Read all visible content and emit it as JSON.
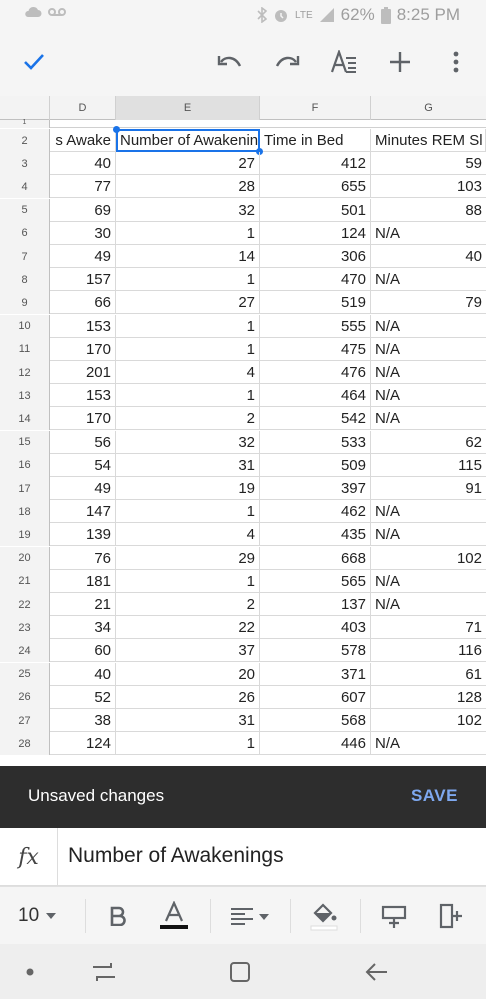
{
  "status_bar": {
    "battery": "62%",
    "time": "8:25 PM",
    "network": "LTE",
    "icons": [
      "cloud-icon",
      "voicemail-icon",
      "bluetooth-icon",
      "alarm-icon",
      "signal-icon",
      "battery-icon"
    ]
  },
  "toolbar": {
    "icons": [
      "check-icon",
      "undo-icon",
      "redo-icon",
      "text-format-icon",
      "add-icon",
      "more-vert-icon"
    ],
    "accent": "#1a73e8"
  },
  "grid": {
    "columns": [
      "D",
      "E",
      "F",
      "G"
    ],
    "selected_column": "E",
    "row1_label": "1",
    "header_row": {
      "row": "2",
      "cells": [
        "s Awake",
        "Number of Awakening",
        "Time in Bed",
        "Minutes REM Sl"
      ]
    },
    "rows": [
      {
        "row": "3",
        "d": "40",
        "e": "27",
        "f": "412",
        "g": "59"
      },
      {
        "row": "4",
        "d": "77",
        "e": "28",
        "f": "655",
        "g": "103"
      },
      {
        "row": "5",
        "d": "69",
        "e": "32",
        "f": "501",
        "g": "88"
      },
      {
        "row": "6",
        "d": "30",
        "e": "1",
        "f": "124",
        "g": "N/A"
      },
      {
        "row": "7",
        "d": "49",
        "e": "14",
        "f": "306",
        "g": "40"
      },
      {
        "row": "8",
        "d": "157",
        "e": "1",
        "f": "470",
        "g": "N/A"
      },
      {
        "row": "9",
        "d": "66",
        "e": "27",
        "f": "519",
        "g": "79"
      },
      {
        "row": "10",
        "d": "153",
        "e": "1",
        "f": "555",
        "g": "N/A"
      },
      {
        "row": "11",
        "d": "170",
        "e": "1",
        "f": "475",
        "g": "N/A"
      },
      {
        "row": "12",
        "d": "201",
        "e": "4",
        "f": "476",
        "g": "N/A"
      },
      {
        "row": "13",
        "d": "153",
        "e": "1",
        "f": "464",
        "g": "N/A"
      },
      {
        "row": "14",
        "d": "170",
        "e": "2",
        "f": "542",
        "g": "N/A"
      },
      {
        "row": "15",
        "d": "56",
        "e": "32",
        "f": "533",
        "g": "62"
      },
      {
        "row": "16",
        "d": "54",
        "e": "31",
        "f": "509",
        "g": "115"
      },
      {
        "row": "17",
        "d": "49",
        "e": "19",
        "f": "397",
        "g": "91"
      },
      {
        "row": "18",
        "d": "147",
        "e": "1",
        "f": "462",
        "g": "N/A"
      },
      {
        "row": "19",
        "d": "139",
        "e": "4",
        "f": "435",
        "g": "N/A"
      },
      {
        "row": "20",
        "d": "76",
        "e": "29",
        "f": "668",
        "g": "102"
      },
      {
        "row": "21",
        "d": "181",
        "e": "1",
        "f": "565",
        "g": "N/A"
      },
      {
        "row": "22",
        "d": "21",
        "e": "2",
        "f": "137",
        "g": "N/A"
      },
      {
        "row": "23",
        "d": "34",
        "e": "22",
        "f": "403",
        "g": "71"
      },
      {
        "row": "24",
        "d": "60",
        "e": "37",
        "f": "578",
        "g": "116"
      },
      {
        "row": "25",
        "d": "40",
        "e": "20",
        "f": "371",
        "g": "61"
      },
      {
        "row": "26",
        "d": "52",
        "e": "26",
        "f": "607",
        "g": "128"
      },
      {
        "row": "27",
        "d": "38",
        "e": "31",
        "f": "568",
        "g": "102"
      },
      {
        "row": "28",
        "d": "124",
        "e": "1",
        "f": "446",
        "g": "N/A"
      }
    ]
  },
  "snackbar": {
    "message": "Unsaved changes",
    "action": "SAVE",
    "action_color": "#7ea8ef"
  },
  "formula_bar": {
    "fx_label": "fx",
    "value": "Number of Awakenings"
  },
  "format_bar": {
    "font_size": "10",
    "icons": [
      "dropdown-icon",
      "bold-icon",
      "text-color-icon",
      "align-icon",
      "fill-color-icon",
      "insert-row-icon",
      "insert-column-icon"
    ]
  },
  "nav_bar": {
    "icons": [
      "dot-icon",
      "recents-icon",
      "home-icon",
      "back-icon"
    ]
  }
}
